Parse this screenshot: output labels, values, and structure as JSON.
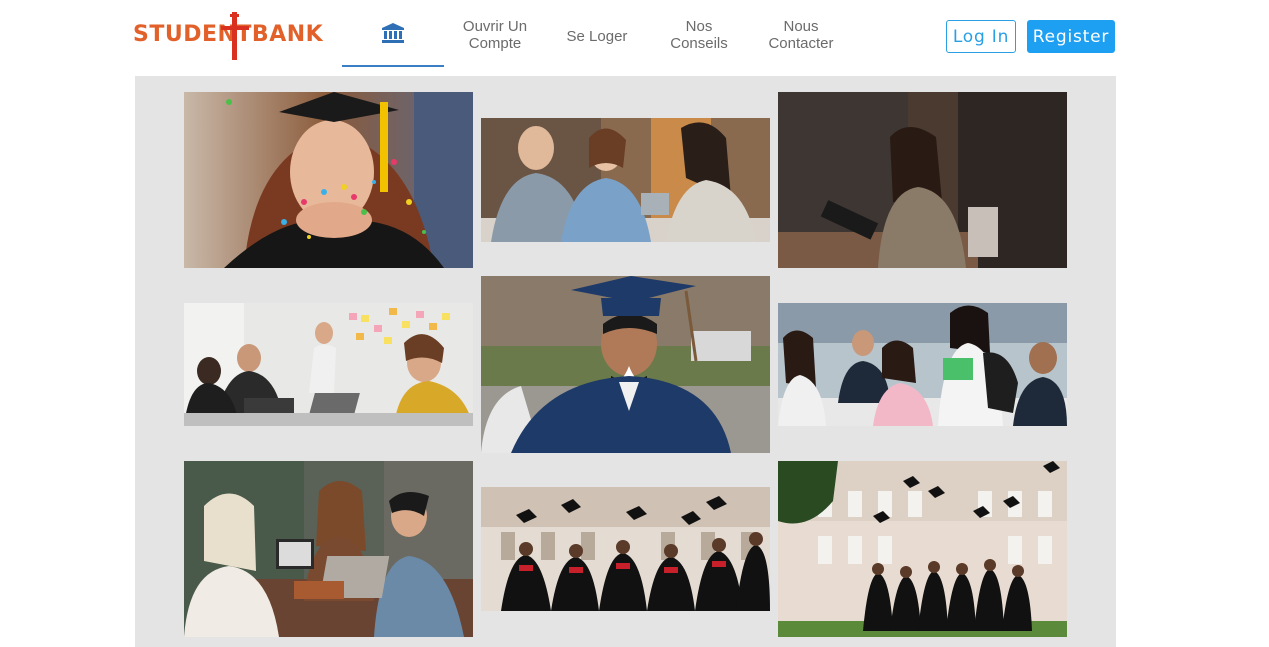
{
  "brand": {
    "logo_text": "STUDENTBANK"
  },
  "nav": {
    "home_icon": "bank-icon",
    "items": [
      {
        "label_line1": "Ouvrir Un",
        "label_line2": "Compte"
      },
      {
        "label_line1": "Se Loger",
        "label_line2": ""
      },
      {
        "label_line1": "Nos",
        "label_line2": "Conseils"
      },
      {
        "label_line1": "Nous",
        "label_line2": "Contacter"
      }
    ]
  },
  "auth": {
    "login_label": "Log In",
    "register_label": "Register"
  },
  "colors": {
    "brand_orange": "#e2612a",
    "accent_blue": "#1d9ff2",
    "gallery_bg": "#e4e4e4"
  },
  "gallery": {
    "photos": [
      {
        "subject": "graduate-blowing-confetti"
      },
      {
        "subject": "students-chatting-at-table"
      },
      {
        "subject": "woman-with-tablet-laughing"
      },
      {
        "subject": "team-meeting-sticky-notes"
      },
      {
        "subject": "smiling-graduate-in-cap"
      },
      {
        "subject": "students-in-classroom"
      },
      {
        "subject": "friends-with-laptop"
      },
      {
        "subject": "graduates-throwing-caps"
      },
      {
        "subject": "graduates-in-front-of-building"
      }
    ]
  }
}
